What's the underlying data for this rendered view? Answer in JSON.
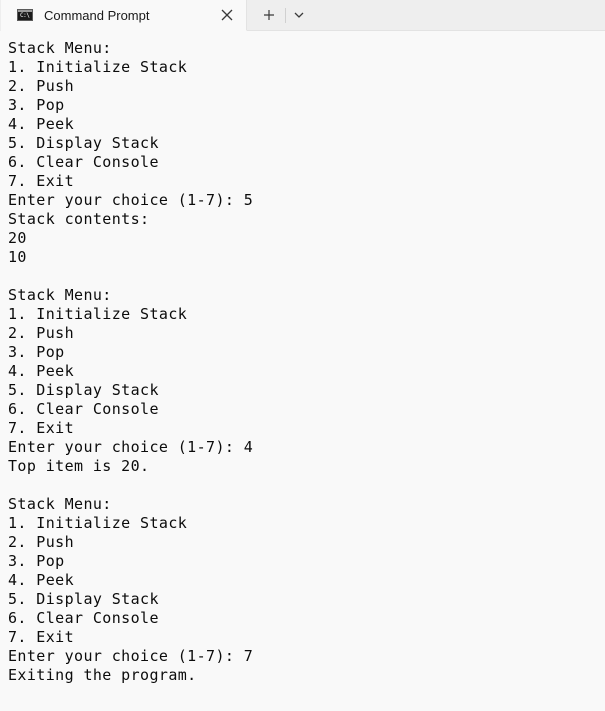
{
  "window": {
    "tab_icon_text": "C:\\",
    "tab_title": "Command Prompt"
  },
  "console": {
    "lines": [
      "Stack Menu:",
      "1. Initialize Stack",
      "2. Push",
      "3. Pop",
      "4. Peek",
      "5. Display Stack",
      "6. Clear Console",
      "7. Exit",
      "Enter your choice (1-7): 5",
      "Stack contents:",
      "20",
      "10",
      "",
      "Stack Menu:",
      "1. Initialize Stack",
      "2. Push",
      "3. Pop",
      "4. Peek",
      "5. Display Stack",
      "6. Clear Console",
      "7. Exit",
      "Enter your choice (1-7): 4",
      "Top item is 20.",
      "",
      "Stack Menu:",
      "1. Initialize Stack",
      "2. Push",
      "3. Pop",
      "4. Peek",
      "5. Display Stack",
      "6. Clear Console",
      "7. Exit",
      "Enter your choice (1-7): 7",
      "Exiting the program."
    ]
  },
  "colors": {
    "background": "#f9f9f9",
    "tabbar": "#eeeeee",
    "text": "#0c0c0c"
  },
  "icons": {
    "tab": "command-prompt-icon",
    "close": "close-icon",
    "new_tab": "plus-icon",
    "dropdown": "chevron-down-icon"
  }
}
